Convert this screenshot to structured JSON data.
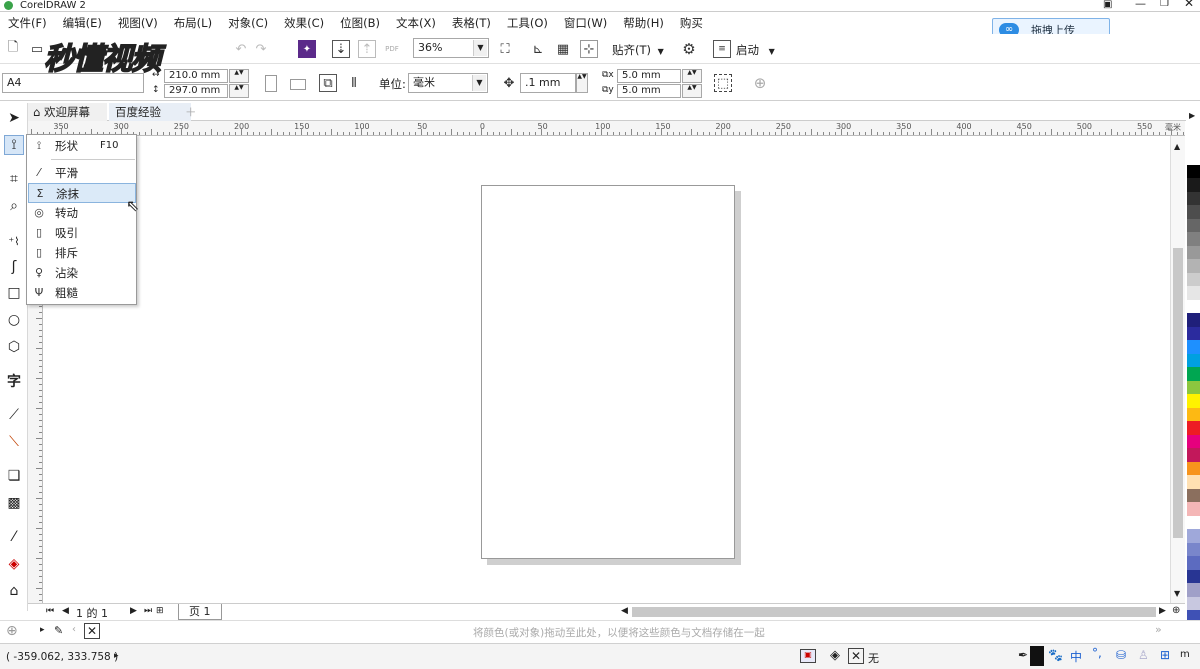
{
  "app": {
    "title": "CorelDRAW 2",
    "logo_text": "秒懂视频"
  },
  "menu": [
    "文件(F)",
    "编辑(E)",
    "视图(V)",
    "布局(L)",
    "对象(C)",
    "效果(C)",
    "位图(B)",
    "文本(X)",
    "表格(T)",
    "工具(O)",
    "窗口(W)",
    "帮助(H)",
    "购买"
  ],
  "upload": {
    "label": "拖拽上传"
  },
  "toolbar1": {
    "zoom": "36%",
    "snap_label": "贴齐(T)",
    "launch_label": "启动"
  },
  "toolbar2": {
    "page_size": "A4",
    "width": "210.0 mm",
    "height": "297.0 mm",
    "units_label": "单位:",
    "units_value": "毫米",
    "nudge": ".1 mm",
    "dup_x": "5.0 mm",
    "dup_y": "5.0 mm"
  },
  "tabs": [
    {
      "label": "欢迎屏幕"
    },
    {
      "label": "百度经验"
    }
  ],
  "ruler_labels": [
    "350",
    "300",
    "250",
    "200",
    "150",
    "100",
    "50",
    "0",
    "50",
    "100",
    "150",
    "200",
    "250",
    "300",
    "350",
    "400",
    "450",
    "500",
    "550"
  ],
  "ruler_unit": "毫米",
  "flyout": [
    {
      "label": "形状",
      "shortcut": "F10",
      "icon": "shape-tool-icon"
    },
    {
      "label": "平滑",
      "shortcut": "",
      "icon": "smooth-icon"
    },
    {
      "label": "涂抹",
      "shortcut": "",
      "icon": "smear-icon",
      "selected": true
    },
    {
      "label": "转动",
      "shortcut": "",
      "icon": "twirl-icon"
    },
    {
      "label": "吸引",
      "shortcut": "",
      "icon": "attract-icon"
    },
    {
      "label": "排斥",
      "shortcut": "",
      "icon": "repel-icon"
    },
    {
      "label": "沾染",
      "shortcut": "",
      "icon": "smudge-icon"
    },
    {
      "label": "粗糙",
      "shortcut": "",
      "icon": "roughen-icon"
    }
  ],
  "page_nav": {
    "current": "1",
    "of": "的",
    "total": "1",
    "page_tab": "页 1"
  },
  "colorbar": {
    "hint": "将颜色(或对象)拖动至此处，以便将这些颜色与文档存储在一起"
  },
  "status": {
    "coords": "( -359.062, 333.758 )",
    "fill_label": "无"
  },
  "ime": {
    "lang": "中"
  },
  "palette_colors": [
    "#ffffff",
    "#000000",
    "#1a1a1a",
    "#333333",
    "#4d4d4d",
    "#666666",
    "#808080",
    "#999999",
    "#b3b3b3",
    "#cccccc",
    "#e6e6e6",
    "#ffffff",
    "#1f1f7a",
    "#2b2b9e",
    "#1e90ff",
    "#00a0e0",
    "#00a651",
    "#8cc63f",
    "#fff200",
    "#fdb913",
    "#ed1c24",
    "#e6007e",
    "#c2185b",
    "#f7941d",
    "#ffe0b2",
    "#8b6f5e",
    "#f4b6b6",
    "#ffffff",
    "#9fa8da",
    "#7986cb",
    "#5c6bc0",
    "#283593",
    "#a0a0c8",
    "#c8c8e0",
    "#3f51b5",
    "#1a237e"
  ]
}
